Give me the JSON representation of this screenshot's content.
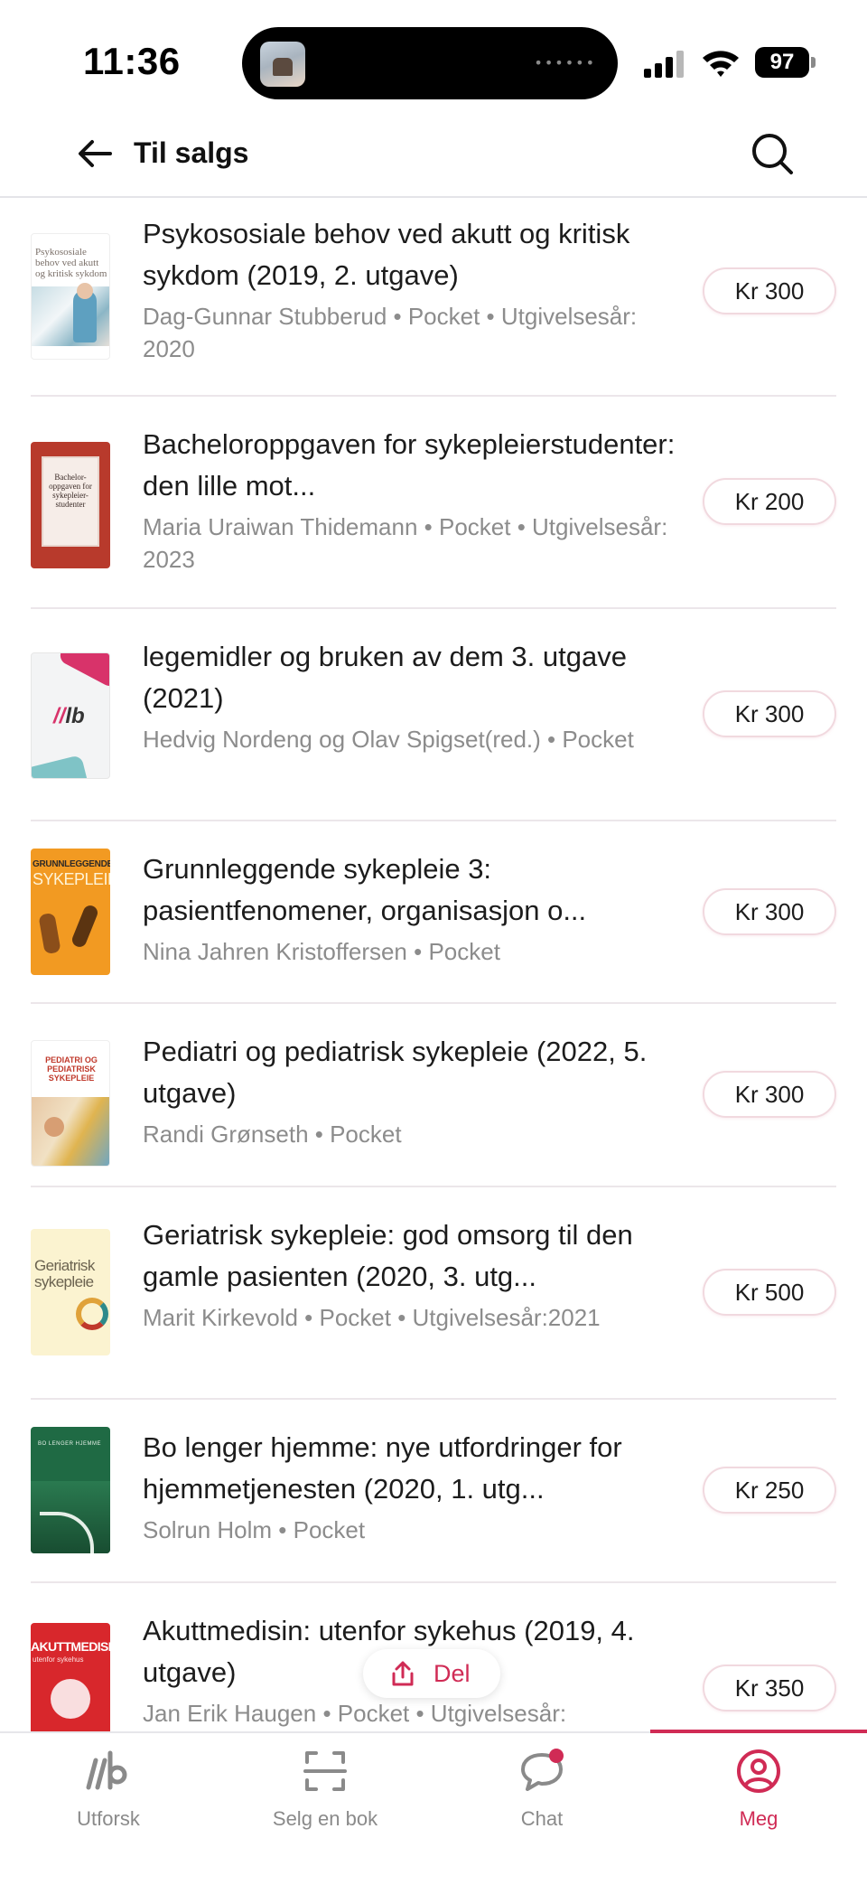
{
  "status_bar": {
    "time": "11:36",
    "battery": "97",
    "island_dots": "••••••"
  },
  "header": {
    "title": "Til salgs",
    "back_icon": "arrow-left-icon",
    "search_icon": "search-icon"
  },
  "listings": [
    {
      "title": "Psykososiale behov ved akutt og kritisk sykdom (2019, 2. utgave)",
      "meta": "Dag-Gunnar Stubberud • Pocket • Utgivelsesår: 2020",
      "price": "Kr 300",
      "cover_text": "Psykososiale behov ved akutt og kritisk sykdom"
    },
    {
      "title": "Bacheloroppgaven for sykepleierstudenter: den lille mot...",
      "meta": "Maria Uraiwan Thidemann • Pocket • Utgivelsesår: 2023",
      "price": "Kr 200",
      "cover_text": "Bachelor-oppgaven for sykepleier-studenter"
    },
    {
      "title": "legemidler og bruken av dem 3. utgave (2021)",
      "meta": "Hedvig Nordeng og Olav Spigset(red.) • Pocket",
      "price": "Kr 300",
      "cover_text": "lb"
    },
    {
      "title": "Grunnleggende sykepleie 3: pasientfenomener, organisasjon o...",
      "meta": "Nina Jahren Kristoffersen • Pocket",
      "price": "Kr 300",
      "cover_text_1": "GRUNNLEGGENDE",
      "cover_text_2": "SYKEPLEIE"
    },
    {
      "title": "Pediatri og pediatrisk sykepleie (2022, 5. utgave)",
      "meta": "Randi Grønseth • Pocket",
      "price": "Kr 300",
      "cover_text": "PEDIATRI OG PEDIATRISK SYKEPLEIE"
    },
    {
      "title": "Geriatrisk sykepleie: god omsorg til den gamle pasienten (2020, 3. utg...",
      "meta": "Marit Kirkevold • Pocket • Utgivelsesår:2021",
      "price": "Kr 500",
      "cover_text": "Geriatrisk sykepleie"
    },
    {
      "title": "Bo lenger hjemme: nye utfordringer for hjemmetjenesten (2020, 1. utg...",
      "meta": "Solrun Holm • Pocket",
      "price": "Kr 250",
      "cover_text": "BO LENGER HJEMME"
    },
    {
      "title": "Akuttmedisin: utenfor sykehus (2019, 4. utgave)",
      "meta": "Jan Erik Haugen • Pocket • Utgivelsesår:",
      "price": "Kr 350",
      "cover_text_1": "AKUTTMEDISIN",
      "cover_text_2": "utenfor sykehus"
    }
  ],
  "share": {
    "label": "Del",
    "icon": "share-icon"
  },
  "tabs": [
    {
      "label": "Utforsk",
      "icon": "explore-icon",
      "active": false
    },
    {
      "label": "Selg en bok",
      "icon": "scan-icon",
      "active": false
    },
    {
      "label": "Chat",
      "icon": "chat-icon",
      "active": false
    },
    {
      "label": "Meg",
      "icon": "profile-icon",
      "active": true
    }
  ],
  "colors": {
    "accent": "#d02b55",
    "text": "#1c1c1c",
    "muted": "#8c8c8c",
    "divider": "#ece6ea",
    "price_border": "#f1d9df"
  }
}
